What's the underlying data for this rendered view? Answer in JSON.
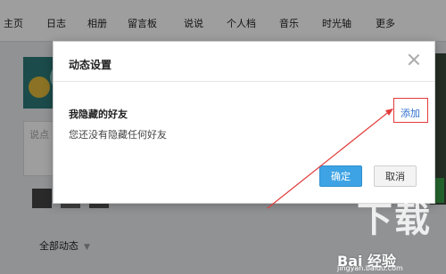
{
  "nav": {
    "items": [
      "主页",
      "日志",
      "相册",
      "留言板",
      "说说",
      "个人档",
      "音乐",
      "时光轴",
      "更多"
    ]
  },
  "background": {
    "post_placeholder": "说点",
    "feed_label": "全部动态"
  },
  "dialog": {
    "title": "动态设置",
    "section_title": "我隐藏的好友",
    "empty_text": "您还没有隐藏任何好友",
    "add_label": "添加",
    "ok_label": "确定",
    "cancel_label": "取消"
  },
  "watermark": {
    "big": "下载",
    "brand": "Bai 经验",
    "url": "jingyan.baidu.com"
  },
  "colors": {
    "accent": "#3da3e4",
    "link": "#2e6fcf",
    "annotation": "#e23b3b"
  }
}
